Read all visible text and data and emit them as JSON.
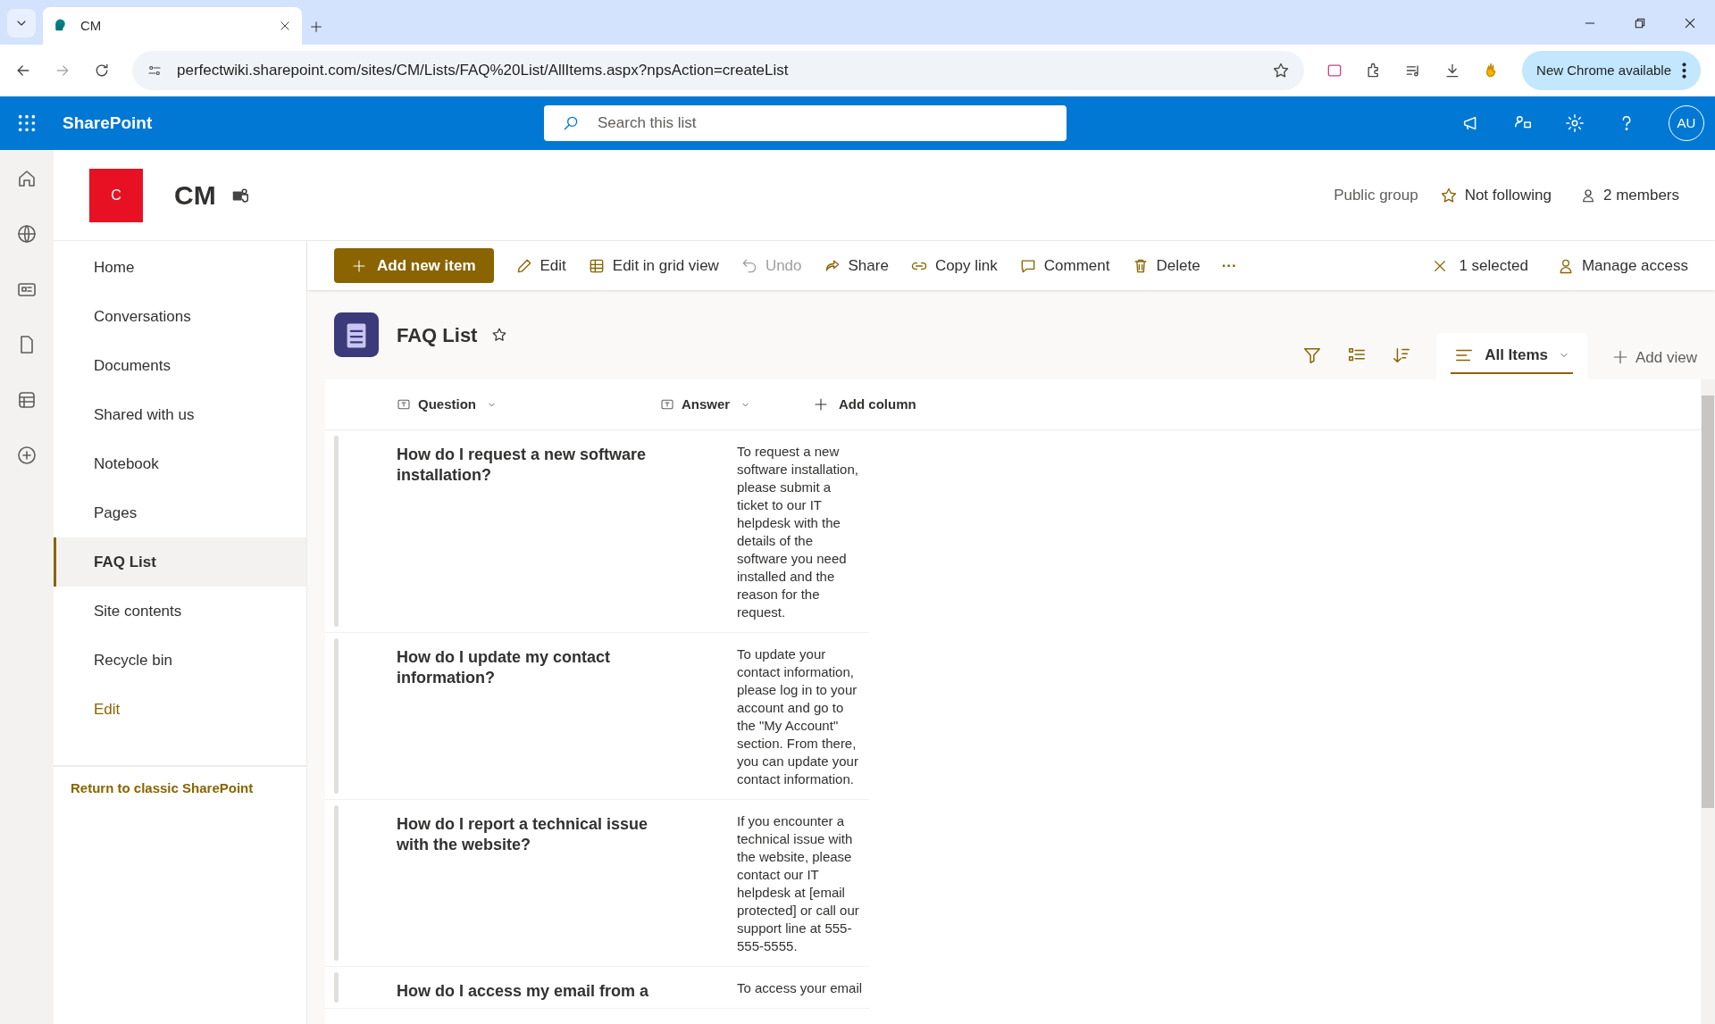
{
  "browser": {
    "tab_title": "CM",
    "address": "perfectwiki.sharepoint.com/sites/CM/Lists/FAQ%20List/AllItems.aspx?npsAction=createList",
    "update_button": "New Chrome available"
  },
  "suite_bar": {
    "app_name": "SharePoint",
    "search": {
      "placeholder": "Search this list"
    },
    "avatar": "AU"
  },
  "site": {
    "logo_letter": "C",
    "title": "CM",
    "group_type": "Public group",
    "follow": "Not following",
    "members": "2 members"
  },
  "nav": {
    "items": [
      {
        "label": "Home",
        "selected": false,
        "kind": "link"
      },
      {
        "label": "Conversations",
        "selected": false,
        "kind": "link"
      },
      {
        "label": "Documents",
        "selected": false,
        "kind": "link"
      },
      {
        "label": "Shared with us",
        "selected": false,
        "kind": "link"
      },
      {
        "label": "Notebook",
        "selected": false,
        "kind": "link"
      },
      {
        "label": "Pages",
        "selected": false,
        "kind": "link"
      },
      {
        "label": "FAQ List",
        "selected": true,
        "kind": "link"
      },
      {
        "label": "Site contents",
        "selected": false,
        "kind": "link"
      },
      {
        "label": "Recycle bin",
        "selected": false,
        "kind": "link"
      },
      {
        "label": "Edit",
        "selected": false,
        "kind": "action"
      }
    ],
    "footer_link": "Return to classic SharePoint"
  },
  "command_bar": {
    "primary": "Add new item",
    "commands": [
      {
        "label": "Edit",
        "disabled": false
      },
      {
        "label": "Edit in grid view",
        "disabled": false
      },
      {
        "label": "Undo",
        "disabled": true
      },
      {
        "label": "Share",
        "disabled": false
      },
      {
        "label": "Copy link",
        "disabled": false
      },
      {
        "label": "Comment",
        "disabled": false
      },
      {
        "label": "Delete",
        "disabled": false
      }
    ],
    "more": "···",
    "selection": "1 selected",
    "manage_access": "Manage access"
  },
  "list": {
    "title": "FAQ List",
    "view": "All Items",
    "add_view": "Add view",
    "columns": [
      {
        "label": "Question"
      },
      {
        "label": "Answer"
      }
    ],
    "add_column": "Add column",
    "rows": [
      {
        "question": "How do I request a new software installation?",
        "answer": "To request a new software installation, please submit a ticket to our IT helpdesk with the details of the software you need installed and the reason for the request."
      },
      {
        "question": "How do I update my contact information?",
        "answer": "To update your contact information, please log in to your account and go to the \"My Account\" section. From there, you can update your contact information."
      },
      {
        "question": "How do I report a technical issue with the website?",
        "answer": "If you encounter a technical issue with the website, please contact our IT helpdesk at [email protected] or call our support line at 555-555-5555."
      },
      {
        "question": "How do I access my email from a",
        "answer": "To access your email"
      }
    ]
  }
}
